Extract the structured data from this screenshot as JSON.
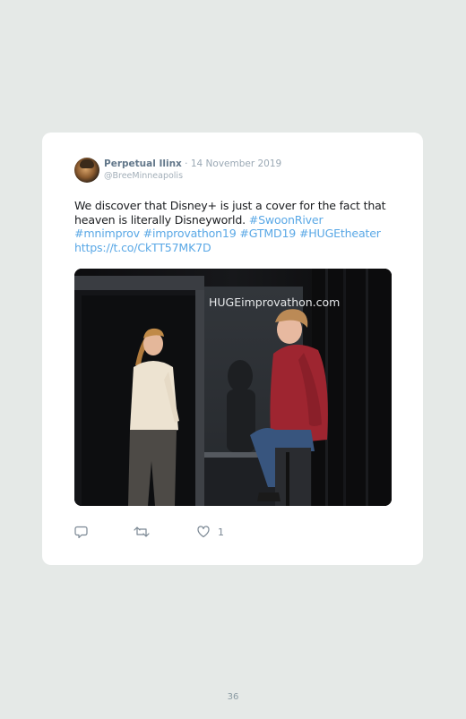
{
  "tweet": {
    "author_name": "Perpetual Ilinx",
    "separator": " · ",
    "date": "14 November 2019",
    "handle": "@BreeMinneapolis",
    "text_plain": "We discover that Disney+ is just a cover for the fact that heaven is literally Disneyworld.",
    "hashtag_1": "#SwoonRiver",
    "hashtag_2": "#mnimprov",
    "hashtag_3": "#improvathon19",
    "hashtag_4": "#GTMD19",
    "hashtag_5": "#HUGEtheater",
    "link": "https://t.co/CkTT57MK7D",
    "photo_sign_text": "HUGEimprovathon.com",
    "like_count": "1"
  },
  "icons": {
    "reply": "reply-icon",
    "retweet": "retweet-icon",
    "like": "heart-icon"
  },
  "colors": {
    "link": "#5aa8e6",
    "background": "#e5e9e7",
    "card": "#ffffff"
  },
  "page": {
    "number": "36"
  }
}
